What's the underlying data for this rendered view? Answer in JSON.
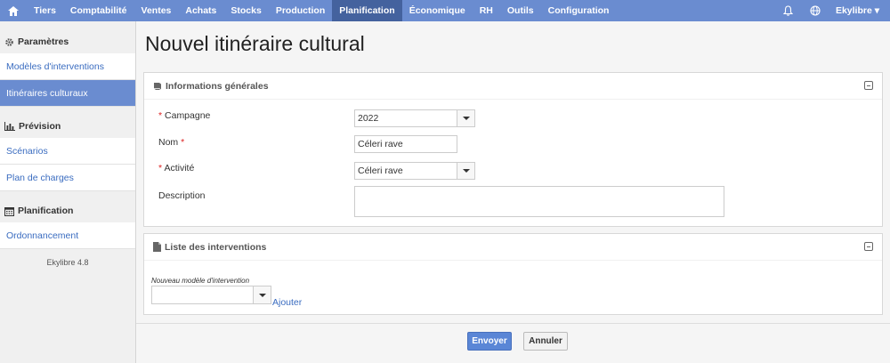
{
  "navbar": {
    "home_icon": "home-icon",
    "items": [
      "Tiers",
      "Comptabilité",
      "Ventes",
      "Achats",
      "Stocks",
      "Production",
      "Planification",
      "Économique",
      "RH",
      "Outils",
      "Configuration"
    ],
    "active": "Planification",
    "user": "Ekylibre ▾",
    "accent": "#6a8cd0",
    "active_color": "#44629e"
  },
  "sidebar": {
    "sections": [
      {
        "title": "Paramètres",
        "icon": "gear-icon",
        "items": [
          "Modèles d'interventions",
          "Itinéraires culturaux"
        ]
      },
      {
        "title": "Prévision",
        "icon": "bar-chart-icon",
        "items": [
          "Scénarios",
          "Plan de charges"
        ]
      },
      {
        "title": "Planification",
        "icon": "calendar-icon",
        "items": [
          "Ordonnancement"
        ]
      }
    ],
    "active_item": "Itinéraires culturaux",
    "version": "Ekylibre 4.8"
  },
  "main": {
    "title": "Nouvel itinéraire cultural",
    "general_panel": {
      "title": "Informations générales",
      "campagne_label": "Campagne",
      "campagne_value": "2022",
      "nom_label": "Nom",
      "nom_value": "Céleri rave",
      "activite_label": "Activité",
      "activite_value": "Céleri rave",
      "description_label": "Description",
      "required_mark": "*"
    },
    "interventions_panel": {
      "title": "Liste des interventions",
      "new_label": "Nouveau modèle d'intervention",
      "add_label": "Ajouter"
    },
    "buttons": {
      "submit": "Envoyer",
      "cancel": "Annuler"
    }
  }
}
